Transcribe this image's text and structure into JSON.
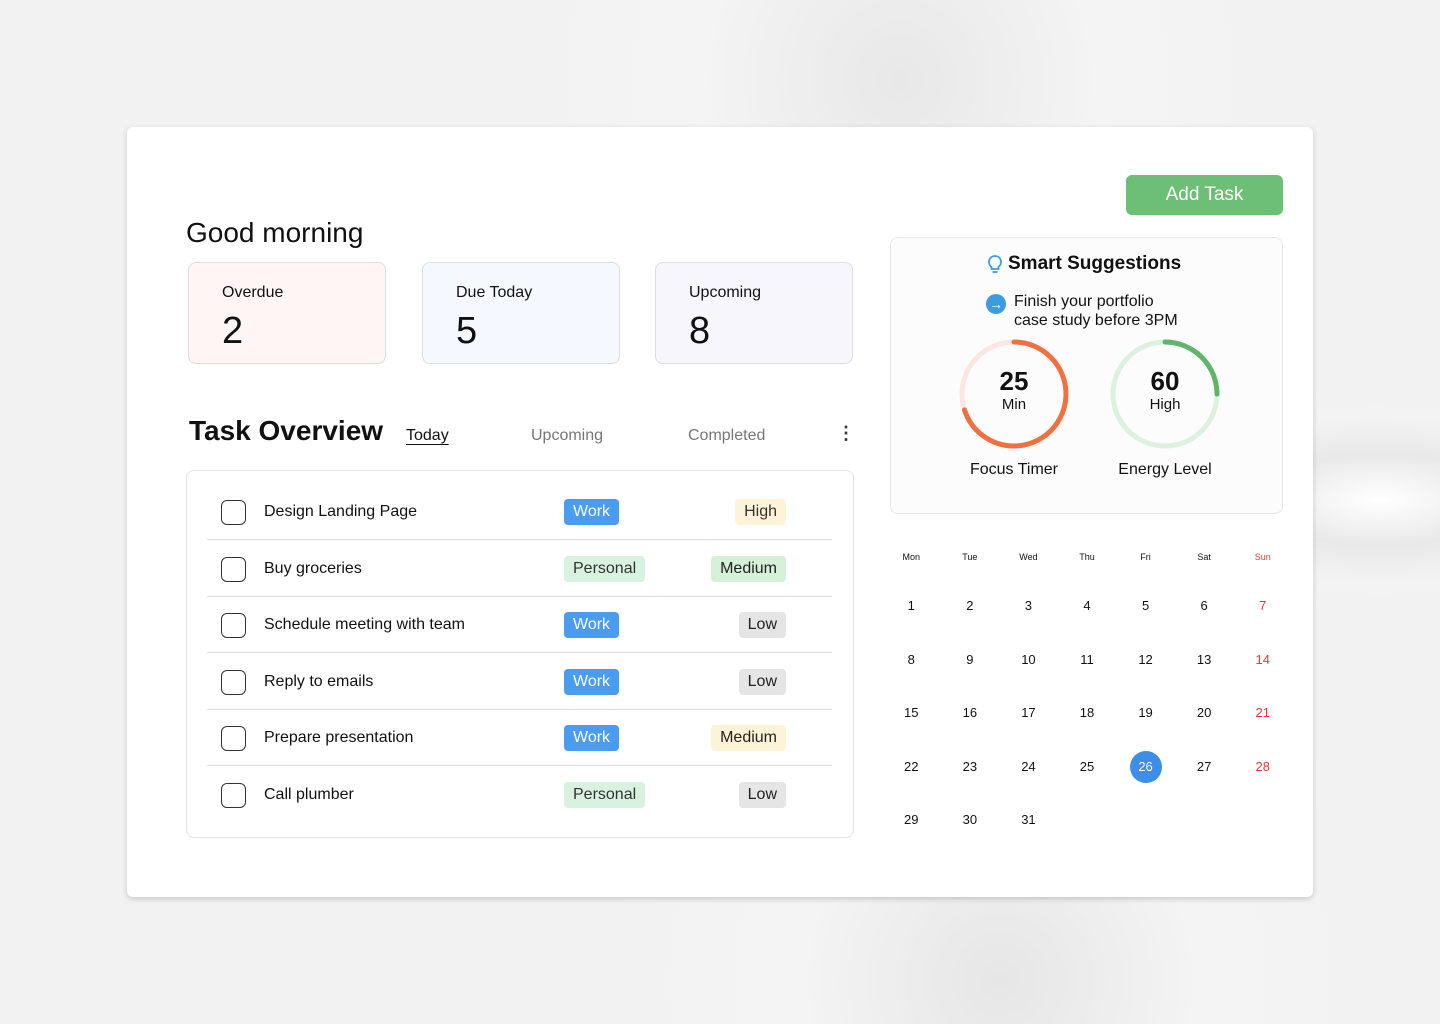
{
  "greeting": "Good morning",
  "stats": [
    {
      "label": "Overdue",
      "value": "2"
    },
    {
      "label": "Due Today",
      "value": "5"
    },
    {
      "label": "Upcoming",
      "value": "8"
    }
  ],
  "overview": {
    "title": "Task Overview",
    "tabs": [
      "Today",
      "Upcoming",
      "Completed"
    ],
    "active_tab": "Today",
    "more_icon": "⋮"
  },
  "tasks": [
    {
      "name": "Design Landing Page",
      "category": "Work",
      "priority": "High"
    },
    {
      "name": "Buy groceries",
      "category": "Personal",
      "priority": "Medium"
    },
    {
      "name": "Schedule meeting with team",
      "category": "Work",
      "priority": "Low"
    },
    {
      "name": "Reply to emails",
      "category": "Work",
      "priority": "Low"
    },
    {
      "name": "Prepare presentation",
      "category": "Work",
      "priority": "Medium"
    },
    {
      "name": "Call plumber",
      "category": "Personal",
      "priority": "Low"
    }
  ],
  "add_task_label": "Add Task",
  "suggestions": {
    "title": "Smart Suggestions",
    "text_line1": "Finish your portfolio",
    "text_line2": "case study before 3PM",
    "focus": {
      "value": "25",
      "unit": "Min",
      "label": "Focus Timer",
      "progress": 0.7,
      "color": "#f07040",
      "track": "#fde6e0"
    },
    "energy": {
      "value": "60",
      "unit": "High",
      "label": "Energy Level",
      "progress": 0.25,
      "color": "#5fb56a",
      "track": "#dcf2df"
    }
  },
  "calendar": {
    "weekdays": [
      "Mon",
      "Tue",
      "Wed",
      "Thu",
      "Fri",
      "Sat",
      "Sun"
    ],
    "days": 31,
    "selected": 26
  }
}
